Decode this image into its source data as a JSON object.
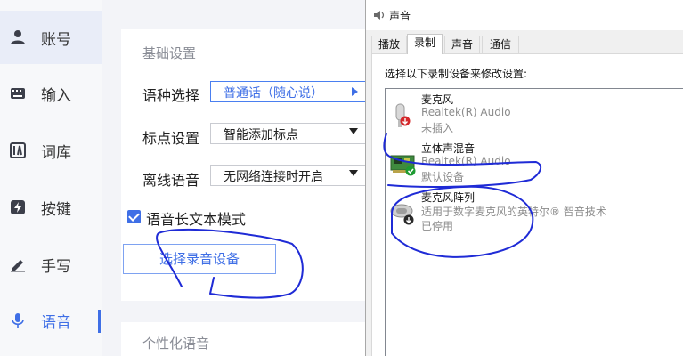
{
  "sidebar": {
    "items": [
      {
        "label": "账号",
        "icon": "user-icon"
      },
      {
        "label": "输入",
        "icon": "keyboard-icon"
      },
      {
        "label": "词库",
        "icon": "lexicon-icon"
      },
      {
        "label": "按键",
        "icon": "key-icon"
      },
      {
        "label": "手写",
        "icon": "pen-icon"
      },
      {
        "label": "语音",
        "icon": "microphone-icon"
      }
    ]
  },
  "settings": {
    "section_title": "基础设置",
    "language_label": "语种选择",
    "language_value": "普通话（随心说）",
    "punct_label": "标点设置",
    "punct_value": "智能添加标点",
    "offline_label": "离线语音",
    "offline_value": "无网络连接时开启",
    "longtext_label": "语音长文本模式",
    "select_device_button": "选择录音设备",
    "section2_title": "个性化语音"
  },
  "dialog": {
    "title": "声音",
    "tabs": [
      "播放",
      "录制",
      "声音",
      "通信"
    ],
    "instruction": "选择以下录制设备来修改设置:",
    "devices": [
      {
        "name": "麦克风",
        "driver": "Realtek(R) Audio",
        "status": "未插入"
      },
      {
        "name": "立体声混音",
        "driver": "Realtek(R) Audio",
        "status": "默认设备"
      },
      {
        "name": "麦克风阵列",
        "driver": "适用于数字麦克风的英特尔® 智音技术",
        "status": "已停用"
      }
    ]
  },
  "colors": {
    "accent": "#3f6fe6",
    "scribble": "#1f2bd6"
  }
}
